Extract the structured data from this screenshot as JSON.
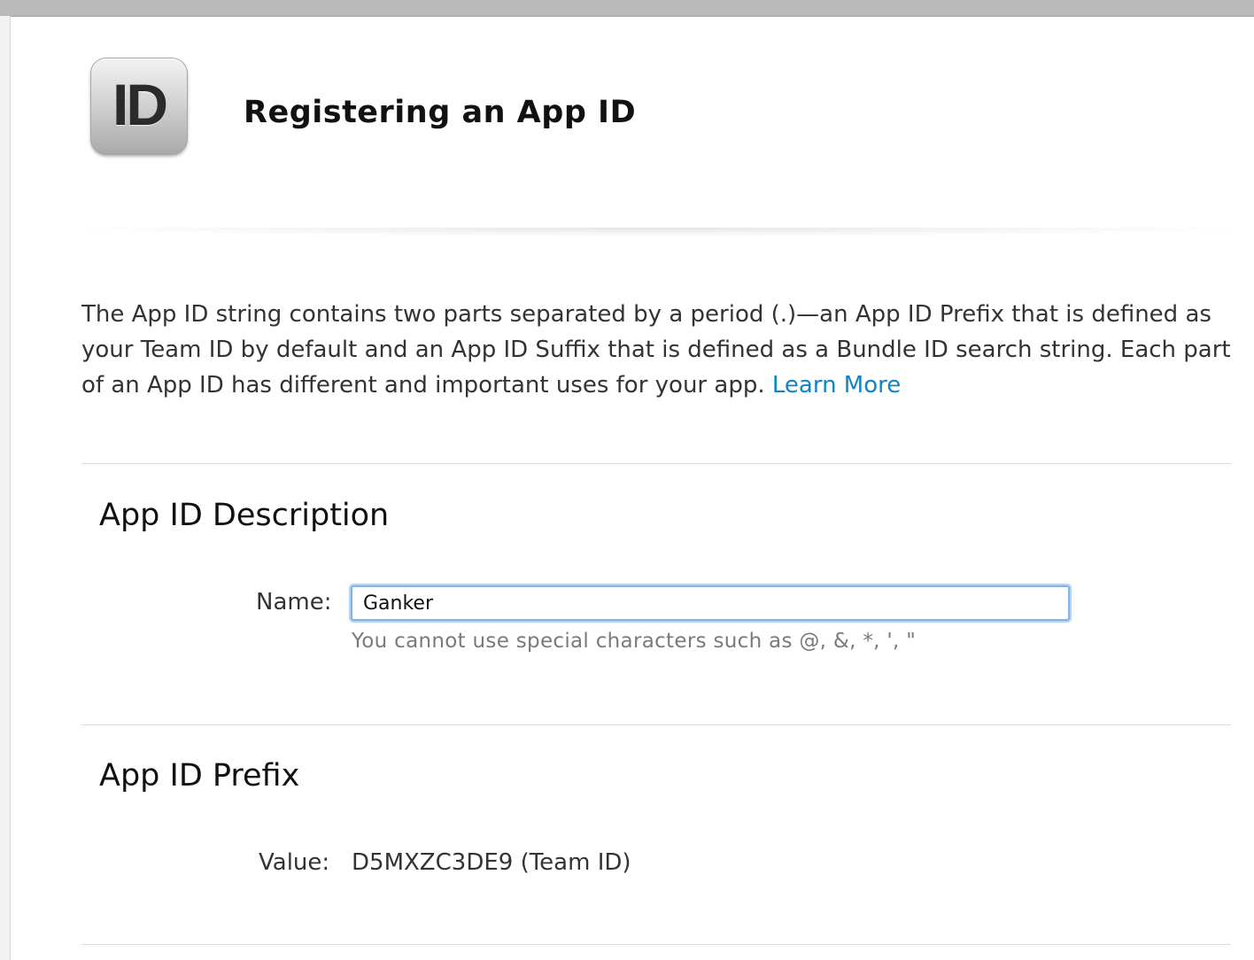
{
  "header": {
    "icon_text": "ID",
    "title": "Registering an App ID"
  },
  "intro": {
    "text": "The App ID string contains two parts separated by a period (.)—an App ID Prefix that is defined as your Team ID by default and an App ID Suffix that is defined as a Bundle ID search string. Each part of an App ID has different and important uses for your app.",
    "link_label": "Learn More"
  },
  "description_section": {
    "title": "App ID Description",
    "name_label": "Name:",
    "name_value": "Ganker",
    "hint": "You cannot use special characters such as @, &, *, ', \""
  },
  "prefix_section": {
    "title": "App ID Prefix",
    "value_label": "Value:",
    "value": "D5MXZC3DE9 (Team ID)"
  },
  "colors": {
    "link": "#0f84c6",
    "input_focus": "#7fb3ea",
    "hint": "#7a7a7a"
  },
  "icons": {
    "app_id": "id-badge-icon"
  }
}
